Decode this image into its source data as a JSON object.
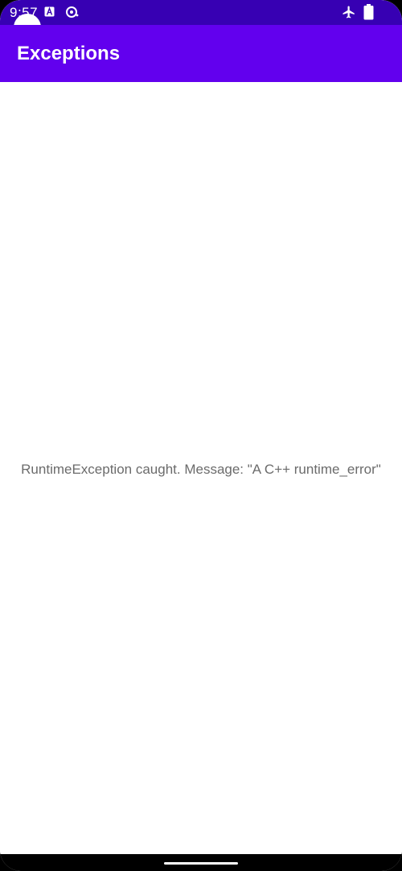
{
  "status_bar": {
    "time": "9:57",
    "icons": {
      "left": [
        "text-a-icon",
        "sync-icon"
      ],
      "right": [
        "airplane-mode-icon",
        "battery-icon"
      ]
    },
    "background": "#3700b3"
  },
  "app_bar": {
    "title": "Exceptions",
    "background": "#6200ee"
  },
  "main": {
    "message": "RuntimeException caught. Message: \"A C++ runtime_error\""
  },
  "colors": {
    "text_primary": "#ffffff",
    "message_text": "#6b6b6b",
    "content_background": "#ffffff"
  }
}
